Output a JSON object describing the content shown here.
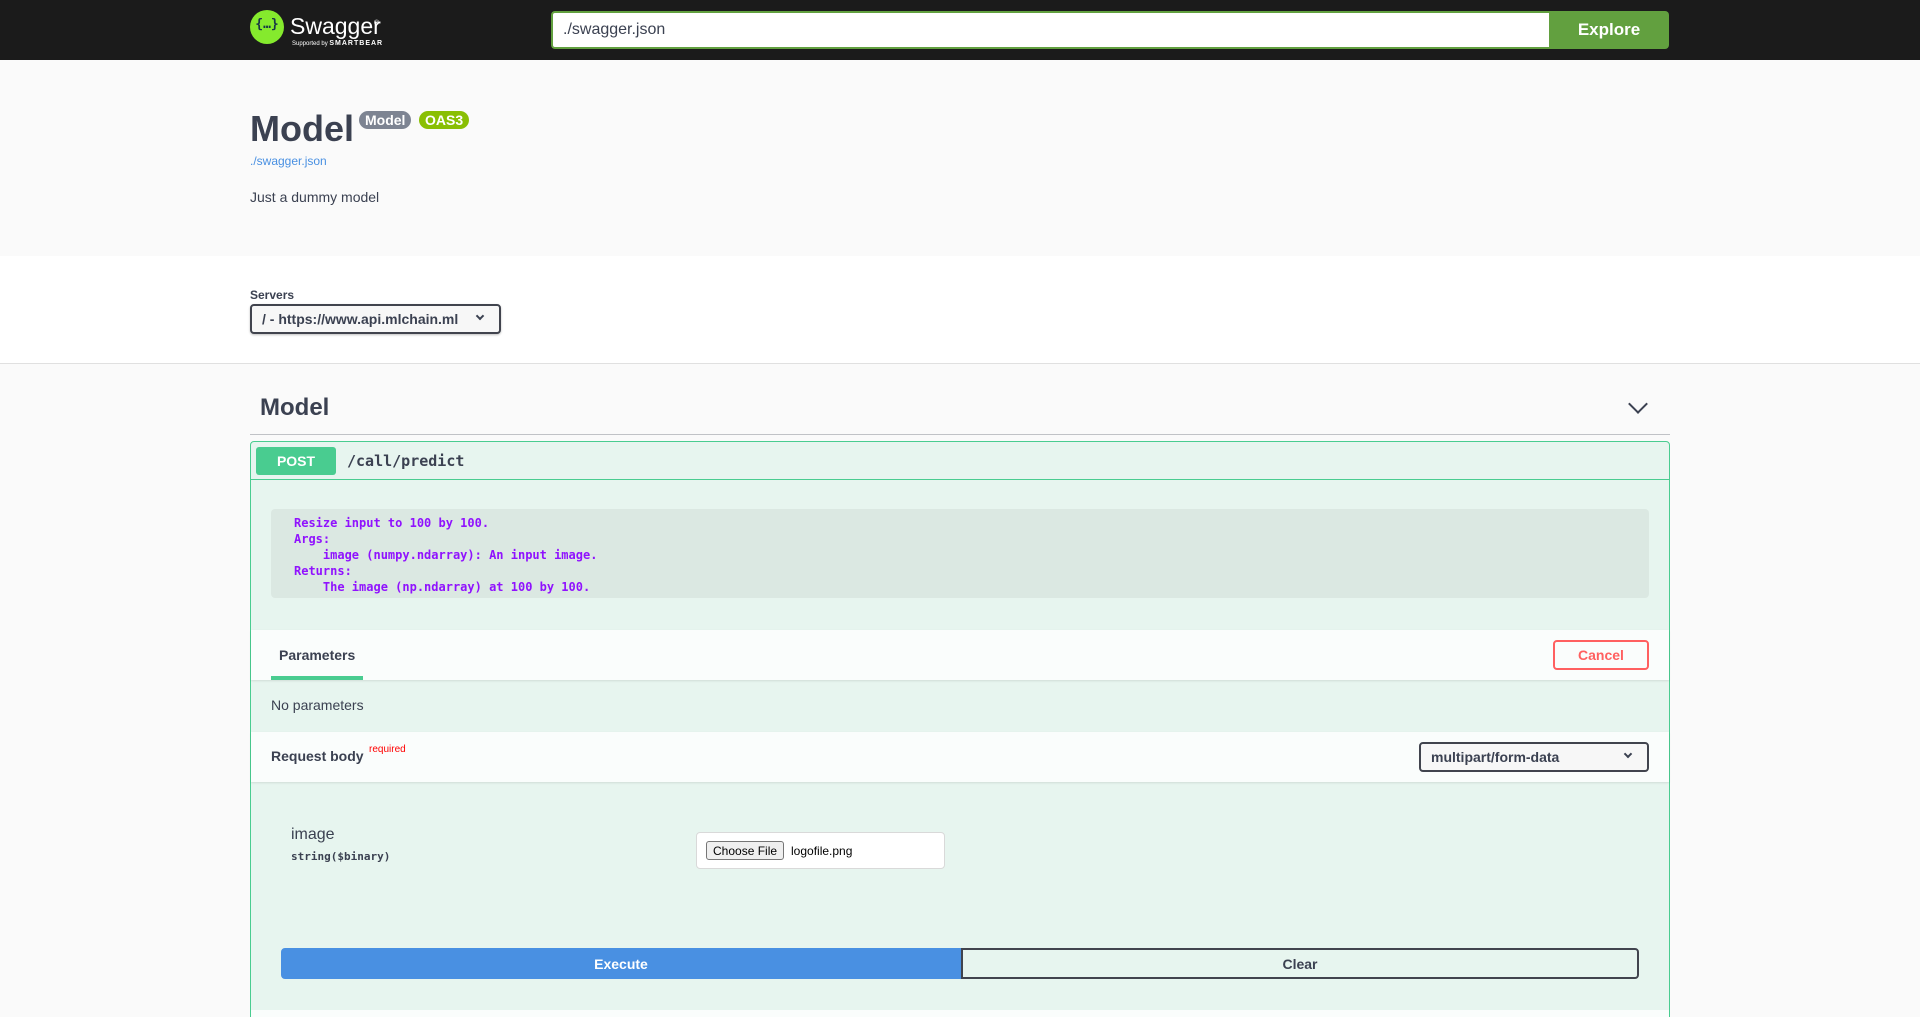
{
  "topbar": {
    "logo_name": "Swagger",
    "logo_tm": "®",
    "logo_supported_by": "Supported by",
    "logo_company": "SMARTBEAR",
    "url_value": "./swagger.json",
    "explore_label": "Explore"
  },
  "info": {
    "title": "Model",
    "version_badge": "Model",
    "oas_badge": "OAS3",
    "spec_link": "./swagger.json",
    "description": "Just a dummy model"
  },
  "servers": {
    "label": "Servers",
    "selected": "/ - https://www.api.mlchain.ml"
  },
  "tag": {
    "name": "Model"
  },
  "operation": {
    "method": "POST",
    "path": "/call/predict",
    "docstring": "Resize input to 100 by 100.\nArgs:\n    image (numpy.ndarray): An input image.\nReturns:\n    The image (np.ndarray) at 100 by 100.",
    "parameters_tab": "Parameters",
    "cancel_label": "Cancel",
    "no_parameters": "No parameters",
    "request_body_label": "Request body",
    "required_label": "required",
    "content_type": "multipart/form-data",
    "param_name": "image",
    "param_type": "string($binary)",
    "choose_file_label": "Choose File",
    "file_name": "logofile.png",
    "execute_label": "Execute",
    "clear_label": "Clear"
  },
  "colors": {
    "topbar": "#1b1b1b",
    "explore": "#62a03f",
    "post": "#49cc90",
    "execute": "#4990e2",
    "cancel": "#ff6060",
    "docstring": "#9012fe"
  }
}
